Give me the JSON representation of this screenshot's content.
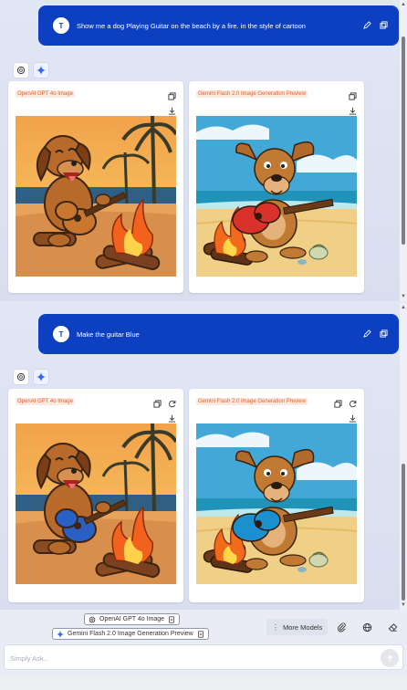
{
  "colors": {
    "bubble": "#0d3fc1",
    "label_text": "#e0622b",
    "label_bg": "#fde9df",
    "background": "#dde2f2"
  },
  "conversation": [
    {
      "avatar": "T",
      "prompt": "Show me a dog Playing Guitar on the beach by a fire. in the style of cartoon",
      "cards": [
        {
          "label": "OpenAI GPT 4o Image",
          "guitar_color": "#c9772e",
          "image": "cartoon-dog-guitar-sunset-beach"
        },
        {
          "label": "Gemini Flash 2.0 Image Generation Preview",
          "guitar_color": "#d8322b",
          "image": "cartoon-dog-guitar-daytime-beach"
        }
      ]
    },
    {
      "avatar": "T",
      "prompt": "Make the guitar Blue",
      "cards": [
        {
          "label": "OpenAI GPT 4o Image",
          "guitar_color": "#2a5fc4",
          "image": "cartoon-dog-blue-guitar-sunset-beach"
        },
        {
          "label": "Gemini Flash 2.0 Image Generation Preview",
          "guitar_color": "#1c8fcf",
          "image": "cartoon-dog-blue-guitar-daytime-beach"
        }
      ]
    }
  ],
  "composer": {
    "selected_models": [
      "OpenAI GPT 4o Image",
      "Gemini Flash 2.0 Image Generation Preview"
    ],
    "more_models": "More Models",
    "placeholder": "Simply Ask..."
  }
}
